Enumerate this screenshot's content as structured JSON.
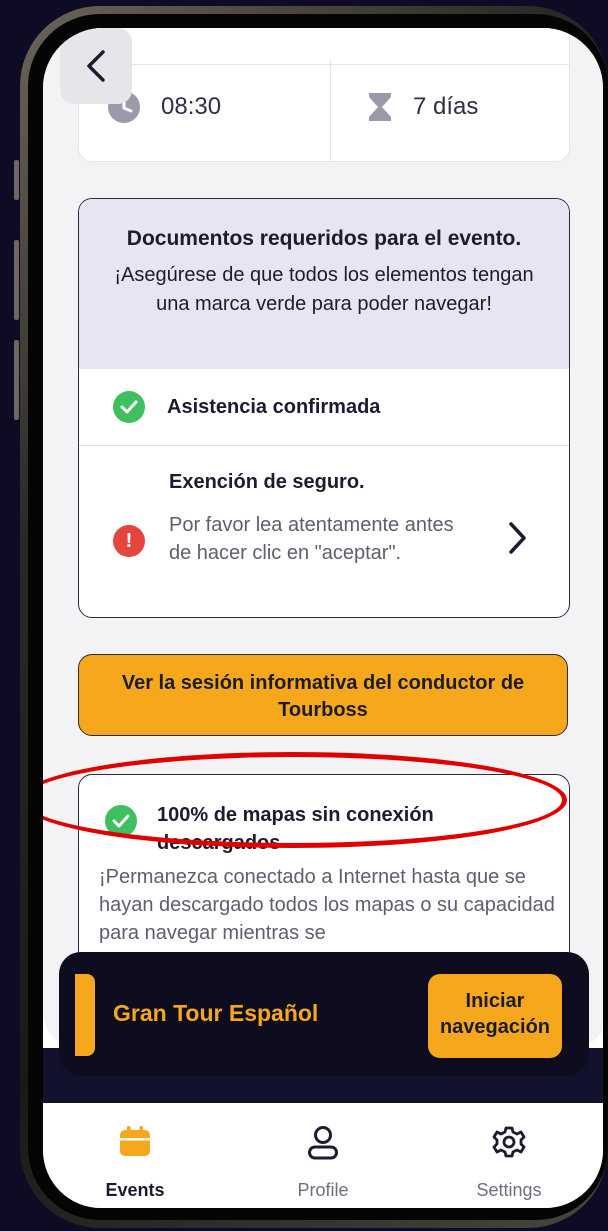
{
  "time_card": {
    "start_time": "08:30",
    "duration": "7 días",
    "clock_icon": "clock-icon",
    "hourglass_icon": "hourglass-icon"
  },
  "documents": {
    "title": "Documentos requeridos para el evento.",
    "subtitle": "¡Asegúrese de que todos los elementos tengan una marca verde para poder navegar!",
    "items": [
      {
        "label": "Asistencia confirmada",
        "status": "ok"
      },
      {
        "label": "Exención de seguro.",
        "description": "Por favor lea atentamente antes de hacer clic en \"aceptar\".",
        "status": "pending"
      }
    ]
  },
  "briefing_button": "Ver la sesión informativa del conductor de Tourboss",
  "offline_maps": {
    "title": "100% de mapas sin conexión descargados",
    "body": "¡Permanezca conectado a Internet hasta que se hayan descargado todos los mapas o su capacidad para navegar mientras se"
  },
  "tour_bar": {
    "tour_name": "Gran Tour Español",
    "start_button": "Iniciar navegación"
  },
  "nav": {
    "items": [
      {
        "label": "Events",
        "icon": "calendar-icon",
        "active": true
      },
      {
        "label": "Profile",
        "icon": "user-icon",
        "active": false
      },
      {
        "label": "Settings",
        "icon": "gear-icon",
        "active": false
      }
    ]
  },
  "colors": {
    "accent": "#f6a71c",
    "success": "#3fbf5f",
    "error": "#e4453f",
    "dark": "#0e0d1f",
    "highlight": "#e00000"
  }
}
